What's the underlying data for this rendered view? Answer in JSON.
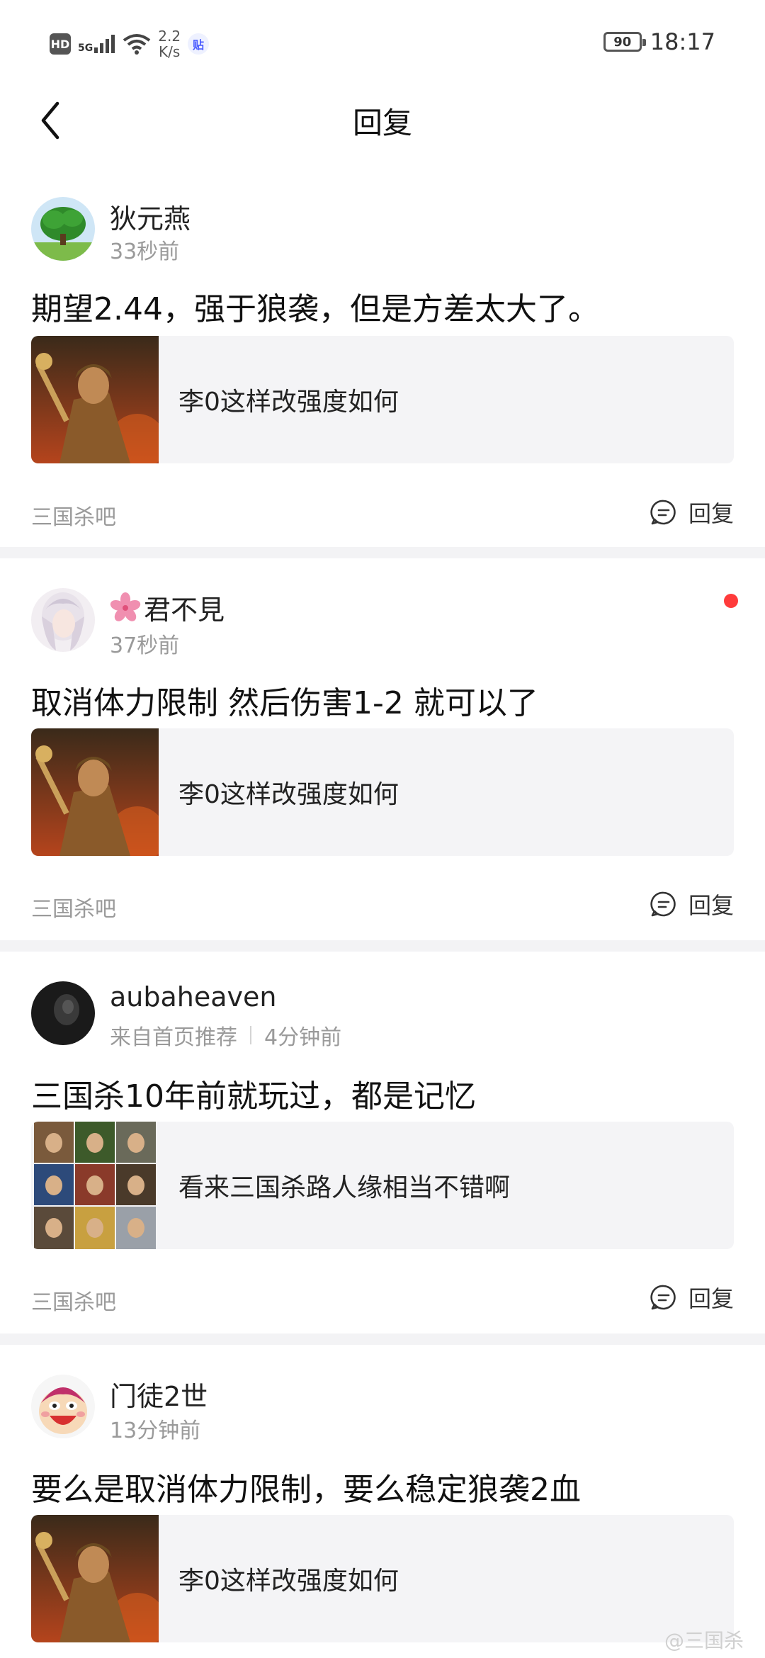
{
  "status_bar": {
    "hd": "HD",
    "network": "5G",
    "speed_value": "2.2",
    "speed_unit": "K/s",
    "app_badge": "贴",
    "battery": "90",
    "time": "18:17"
  },
  "nav": {
    "title": "回复"
  },
  "replies": [
    {
      "username": "狄元燕",
      "time": "33秒前",
      "content": "期望2.44，强于狼袭，但是方差太大了。",
      "quote_text": "李0这样改强度如何",
      "forum": "三国杀吧",
      "reply_label": "回复"
    },
    {
      "username": "君不見",
      "time": "37秒前",
      "content": "取消体力限制 然后伤害1-2   就可以了",
      "quote_text": "李0这样改强度如何",
      "forum": "三国杀吧",
      "reply_label": "回复"
    },
    {
      "username": "aubaheaven",
      "source": "来自首页推荐",
      "time": "4分钟前",
      "content": "三国杀10年前就玩过，都是记忆",
      "quote_text": "看来三国杀路人缘相当不错啊",
      "forum": "三国杀吧",
      "reply_label": "回复"
    },
    {
      "username": "门徒2世",
      "time": "13分钟前",
      "content": "要么是取消体力限制，要么稳定狼袭2血",
      "quote_text": "李0这样改强度如何"
    }
  ],
  "watermark": "@三国杀",
  "colors": {
    "unread_dot": "#ff3b3b",
    "divider": "#f3f3f5",
    "quote_bg": "#f4f4f6",
    "meta_text": "#9a9a9a"
  }
}
